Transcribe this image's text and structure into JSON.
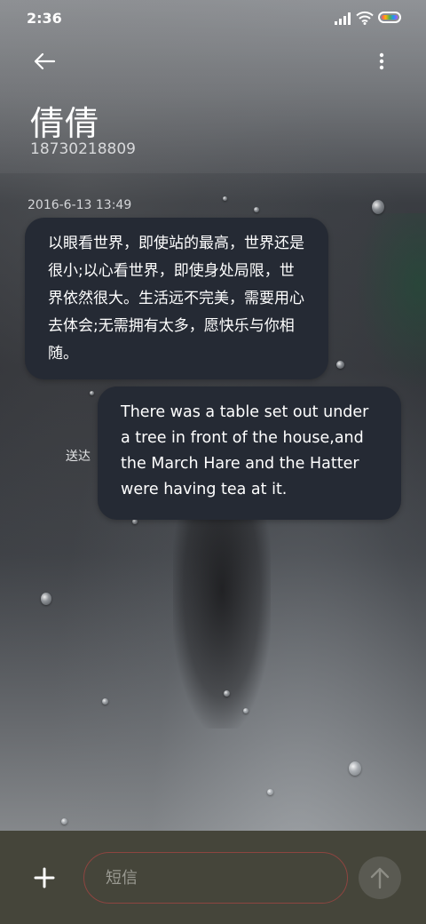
{
  "status_bar": {
    "time": "2:36",
    "icons": [
      "signal-icon",
      "wifi-icon",
      "battery-icon"
    ]
  },
  "app_bar": {
    "back_icon": "back-arrow-icon",
    "more_icon": "more-vert-icon"
  },
  "contact": {
    "name": "倩倩",
    "number": "18730218809"
  },
  "conversation": {
    "timestamp": "2016-6-13 13:49",
    "messages": [
      {
        "direction": "incoming",
        "text": "以眼看世界，即使站的最高，世界还是很小;以心看世界，即使身处局限，世界依然很大。生活远不完美，需要用心去体会;无需拥有太多，愿快乐与你相随。"
      },
      {
        "direction": "outgoing",
        "text": "There was a table set out under a tree in front of the house,and the March Hare and the Hatter were having tea at it.",
        "status": "送达"
      }
    ]
  },
  "composer": {
    "add_icon": "plus-icon",
    "placeholder": "短信",
    "value": "",
    "send_icon": "send-arrow-up-icon"
  },
  "colors": {
    "bubble": "#252a34",
    "bottom_bar": "#45453a",
    "input_border": "#c84646"
  }
}
